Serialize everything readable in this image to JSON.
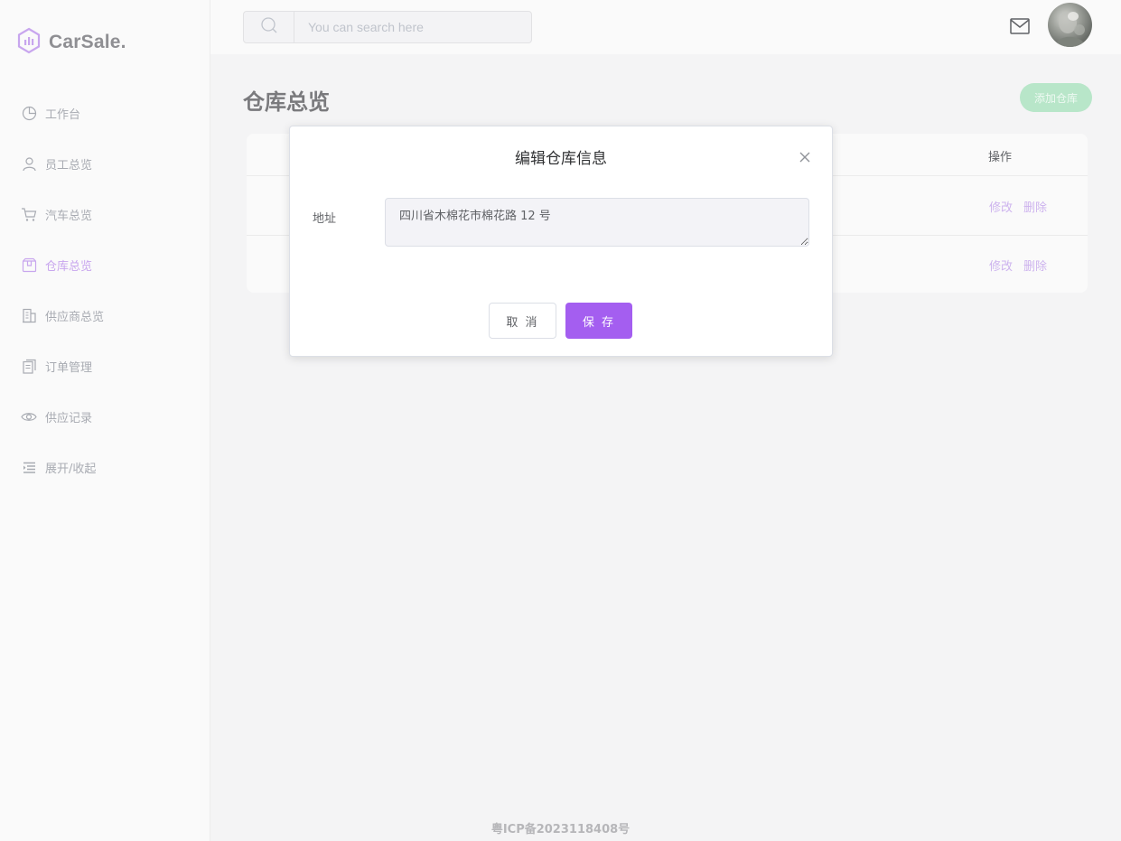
{
  "app": {
    "logo_text": "CarSale."
  },
  "sidebar": {
    "items": [
      {
        "label": "工作台",
        "icon": "pie-chart-icon",
        "active": false
      },
      {
        "label": "员工总览",
        "icon": "user-icon",
        "active": false
      },
      {
        "label": "汽车总览",
        "icon": "cart-icon",
        "active": false
      },
      {
        "label": "仓库总览",
        "icon": "box-icon",
        "active": true
      },
      {
        "label": "供应商总览",
        "icon": "office-building-icon",
        "active": false
      },
      {
        "label": "订单管理",
        "icon": "document-copy-icon",
        "active": false
      },
      {
        "label": "供应记录",
        "icon": "eye-icon",
        "active": false
      },
      {
        "label": "展开/收起",
        "icon": "collapse-menu-icon",
        "active": false
      }
    ]
  },
  "header": {
    "search": {
      "placeholder": "You can search here",
      "value": ""
    }
  },
  "main": {
    "page_title": "仓库总览",
    "add_button": "添加仓库",
    "table": {
      "op_header": "操作",
      "rows": [
        {
          "edit": "修改",
          "delete": "删除"
        },
        {
          "edit": "修改",
          "delete": "删除"
        }
      ]
    }
  },
  "dialog": {
    "title": "编辑仓库信息",
    "address_label": "地址",
    "address_value": "四川省木棉花市棉花路 12 号",
    "cancel": "取 消",
    "save": "保 存"
  },
  "footer": {
    "icp": "粤ICP备2023118408号"
  },
  "colors": {
    "accent": "#a45ef0",
    "active_nav": "#c8a6ee",
    "add_button_bg": "#b8e6c9",
    "link": "#cdb3ee"
  }
}
